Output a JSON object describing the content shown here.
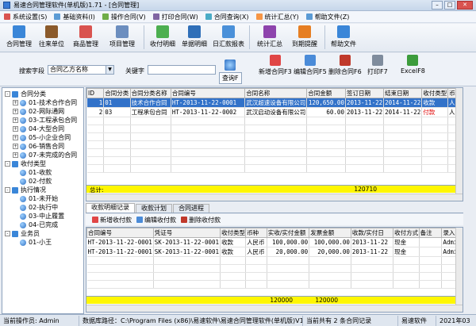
{
  "window": {
    "title": "易速合同管理软件(单机版)1.71 - [合同管理]"
  },
  "menu": [
    {
      "label": "系统设置(S)",
      "color": "#d9534f"
    },
    {
      "label": "基础资料(I)",
      "color": "#5b9bd5"
    },
    {
      "label": "操作合同(V)",
      "color": "#70ad47"
    },
    {
      "label": "打印合同(W)",
      "color": "#8064a2"
    },
    {
      "label": "合同查询(X)",
      "color": "#4bacc6"
    },
    {
      "label": "统计汇总(Y)",
      "color": "#f79646"
    },
    {
      "label": "帮助文件(Z)",
      "color": "#5b9bd5"
    }
  ],
  "toolbar": [
    {
      "label": "合同管理",
      "icon": "contract-icon",
      "color": "#3a86d8"
    },
    {
      "label": "往来单位",
      "icon": "company-icon",
      "color": "#8b5a2b"
    },
    {
      "label": "商品管理",
      "icon": "goods-icon",
      "color": "#d9534f"
    },
    {
      "label": "项目管理",
      "icon": "project-icon",
      "color": "#6c8ebf"
    },
    {
      "label": "收付明细",
      "icon": "payment-detail-icon",
      "color": "#4caf50"
    },
    {
      "label": "单据明细",
      "icon": "document-detail-icon",
      "color": "#2f6fb8"
    },
    {
      "label": "日汇款报表",
      "icon": "daily-report-icon",
      "color": "#4a90d9"
    },
    {
      "label": "统计汇总",
      "icon": "statistics-icon",
      "color": "#8e44ad"
    },
    {
      "label": "到期提醒",
      "icon": "reminder-icon",
      "color": "#e67e22"
    },
    {
      "label": "帮助文件",
      "icon": "help-icon",
      "color": "#3a86d8"
    }
  ],
  "search": {
    "field_label": "搜索字段",
    "field_value": "合同乙方名称",
    "keyword_label": "关键字",
    "query_label": "查询F",
    "new_label": "新增合同F3",
    "edit_label": "编辑合同F5",
    "delete_label": "删除合同F6",
    "print_label": "打印F7",
    "excel_label": "ExcelF8"
  },
  "tree": [
    {
      "level": 0,
      "label": "合同分类",
      "exp": "-",
      "kind": "folder"
    },
    {
      "level": 1,
      "label": "01-技术合作合同",
      "exp": "+",
      "kind": "leaf"
    },
    {
      "level": 1,
      "label": "02-网际通网",
      "exp": "+",
      "kind": "leaf"
    },
    {
      "level": 1,
      "label": "03-工程承包合同",
      "exp": "+",
      "kind": "leaf"
    },
    {
      "level": 1,
      "label": "04-大型合同",
      "exp": "+",
      "kind": "leaf"
    },
    {
      "level": 1,
      "label": "05-小企业合同",
      "exp": "+",
      "kind": "leaf"
    },
    {
      "level": 1,
      "label": "06-销售合同",
      "exp": "+",
      "kind": "leaf"
    },
    {
      "level": 1,
      "label": "07-未完成的合同",
      "exp": "+",
      "kind": "leaf"
    },
    {
      "level": 0,
      "label": "收付类型",
      "exp": "-",
      "kind": "folder"
    },
    {
      "level": 1,
      "label": "01-收款",
      "exp": "",
      "kind": "leaf"
    },
    {
      "level": 1,
      "label": "02-付款",
      "exp": "",
      "kind": "leaf"
    },
    {
      "level": 0,
      "label": "执行情况",
      "exp": "-",
      "kind": "folder"
    },
    {
      "level": 1,
      "label": "01-未开始",
      "exp": "",
      "kind": "leaf"
    },
    {
      "level": 1,
      "label": "02-执行中",
      "exp": "",
      "kind": "leaf"
    },
    {
      "level": 1,
      "label": "03-中止履置",
      "exp": "",
      "kind": "leaf"
    },
    {
      "level": 1,
      "label": "04-已完成",
      "exp": "",
      "kind": "leaf"
    },
    {
      "level": 0,
      "label": "业务员",
      "exp": "-",
      "kind": "folder"
    },
    {
      "level": 1,
      "label": "01-小王",
      "exp": "",
      "kind": "leaf"
    }
  ],
  "contracts": {
    "columns": [
      "ID",
      "合同分类",
      "合同分类名称",
      "合同编号",
      "合同名称",
      "合同金额",
      "签订日期",
      "结束日期",
      "收付类型",
      "币种"
    ],
    "rows": [
      [
        "1",
        "01",
        "技术合作合同",
        "HT-2013-11-22-0001",
        "武汉超速设备有限公司",
        "120,650.00",
        "2013-11-22",
        "2014-11-22",
        "收款",
        "人民"
      ],
      [
        "2",
        "03",
        "工程承包合同",
        "HT-2013-11-22-0002",
        "武汉启动设备有限公司",
        "60.00",
        "2013-11-22",
        "2014-11-22",
        "付款",
        "人民"
      ]
    ],
    "total_label": "总计:",
    "total_value": "120710"
  },
  "tabs": [
    "收款明细记录",
    "收款计划",
    "合同进程"
  ],
  "sub_actions": [
    "新增收付款",
    "编辑收付款",
    "删除收付款"
  ],
  "payments": {
    "columns": [
      "合同编号",
      "凭证号",
      "收付类型",
      "币种",
      "实收/实付金额",
      "发票金额",
      "收款/实付日",
      "收付方式",
      "备注",
      "录入人"
    ],
    "rows": [
      [
        "HT-2013-11-22-0001",
        "SK-2013-11-22-0001",
        "收款",
        "人民币",
        "100,000.00",
        "100,000.00",
        "2013-11-22",
        "现金",
        "",
        "Admin"
      ],
      [
        "HT-2013-11-22-0001",
        "SK-2013-11-22-0001",
        "收款",
        "人民币",
        "20,000.00",
        "20,000.00",
        "2013-11-22",
        "现金",
        "",
        "Admin"
      ]
    ],
    "total_value_1": "120000",
    "total_value_2": "120000"
  },
  "status": {
    "operator": "当前操作员: Admin",
    "path": "数据库路径：C:\\Program Files (x86)\\易速软件\\易速合同管理软件(单机版)V1.71\\DataB",
    "count": "当前共有 2 条合同记录",
    "brand": "易速软件",
    "date": "2021年03"
  }
}
